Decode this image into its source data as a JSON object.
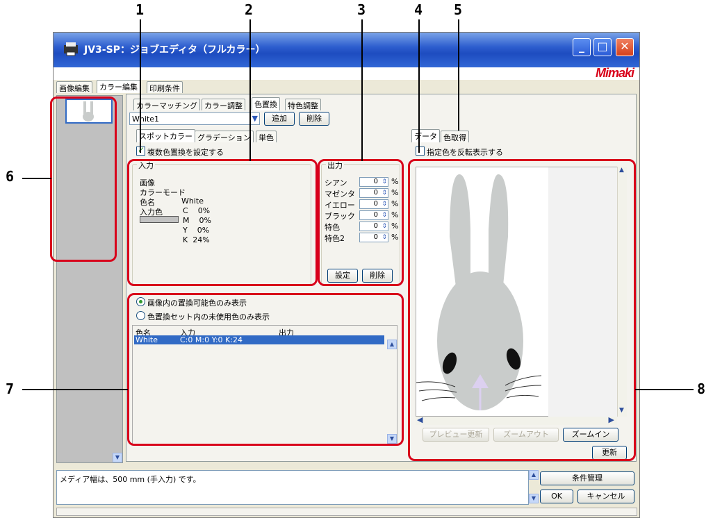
{
  "callouts": [
    "1",
    "2",
    "3",
    "4",
    "5",
    "6",
    "7",
    "8"
  ],
  "window": {
    "title": "JV3-SP：ジョブエディタ（フルカラー）",
    "brand": "Mimaki"
  },
  "main_tabs": [
    "画像編集",
    "カラー編集",
    "印刷条件"
  ],
  "sub_tabs": [
    "カラーマッチング",
    "カラー調整",
    "色置換",
    "特色調整"
  ],
  "color_set": {
    "value": "White1",
    "add_label": "追加",
    "delete_label": "削除"
  },
  "tabs_left": [
    "スポットカラー",
    "グラデーション",
    "単色"
  ],
  "tabs_right": [
    "データ",
    "色取得"
  ],
  "multi_replace_label": "複数色置換を設定する",
  "invert_label": "指定色を反転表示する",
  "input_group": {
    "title": "入力",
    "image_label": "画像",
    "color_mode_label": "カラーモード",
    "color_name_label": "色名",
    "color_name_value": "White",
    "input_color_label": "入力色",
    "cmyk": [
      {
        "ch": "C",
        "val": "0%"
      },
      {
        "ch": "M",
        "val": "0%"
      },
      {
        "ch": "Y",
        "val": "0%"
      },
      {
        "ch": "K",
        "val": "24%"
      }
    ]
  },
  "output_group": {
    "title": "出力",
    "rows": [
      {
        "label": "シアン",
        "value": "0",
        "unit": "%"
      },
      {
        "label": "マゼンタ",
        "value": "0",
        "unit": "%"
      },
      {
        "label": "イエロー",
        "value": "0",
        "unit": "%"
      },
      {
        "label": "ブラック",
        "value": "0",
        "unit": "%"
      },
      {
        "label": "特色",
        "value": "0",
        "unit": "%"
      },
      {
        "label": "特色2",
        "value": "0",
        "unit": "%"
      }
    ],
    "set_label": "設定",
    "delete_label": "削除"
  },
  "filter": {
    "option1": "画像内の置換可能色のみ表示",
    "option2": "色置換セット内の未使用色のみ表示",
    "selected": 0
  },
  "table": {
    "headers": [
      "色名",
      "入力",
      "出力"
    ],
    "rows": [
      [
        "White",
        "C:0 M:0 Y:0 K:24",
        ""
      ]
    ]
  },
  "preview": {
    "update_label": "プレビュー更新",
    "zoom_out_label": "ズームアウト",
    "zoom_in_label": "ズームイン",
    "refresh_label": "更新"
  },
  "status": {
    "message": "メディア幅は、500 mm (手入力) です。",
    "condition_label": "条件管理",
    "ok_label": "OK",
    "cancel_label": "キャンセル"
  },
  "colors": {
    "accent": "#d8001a",
    "titlebar": "#2f5fcf",
    "selection": "#316ac5",
    "rabbit": "#c9cccb",
    "nose": "#dcd0f0"
  }
}
